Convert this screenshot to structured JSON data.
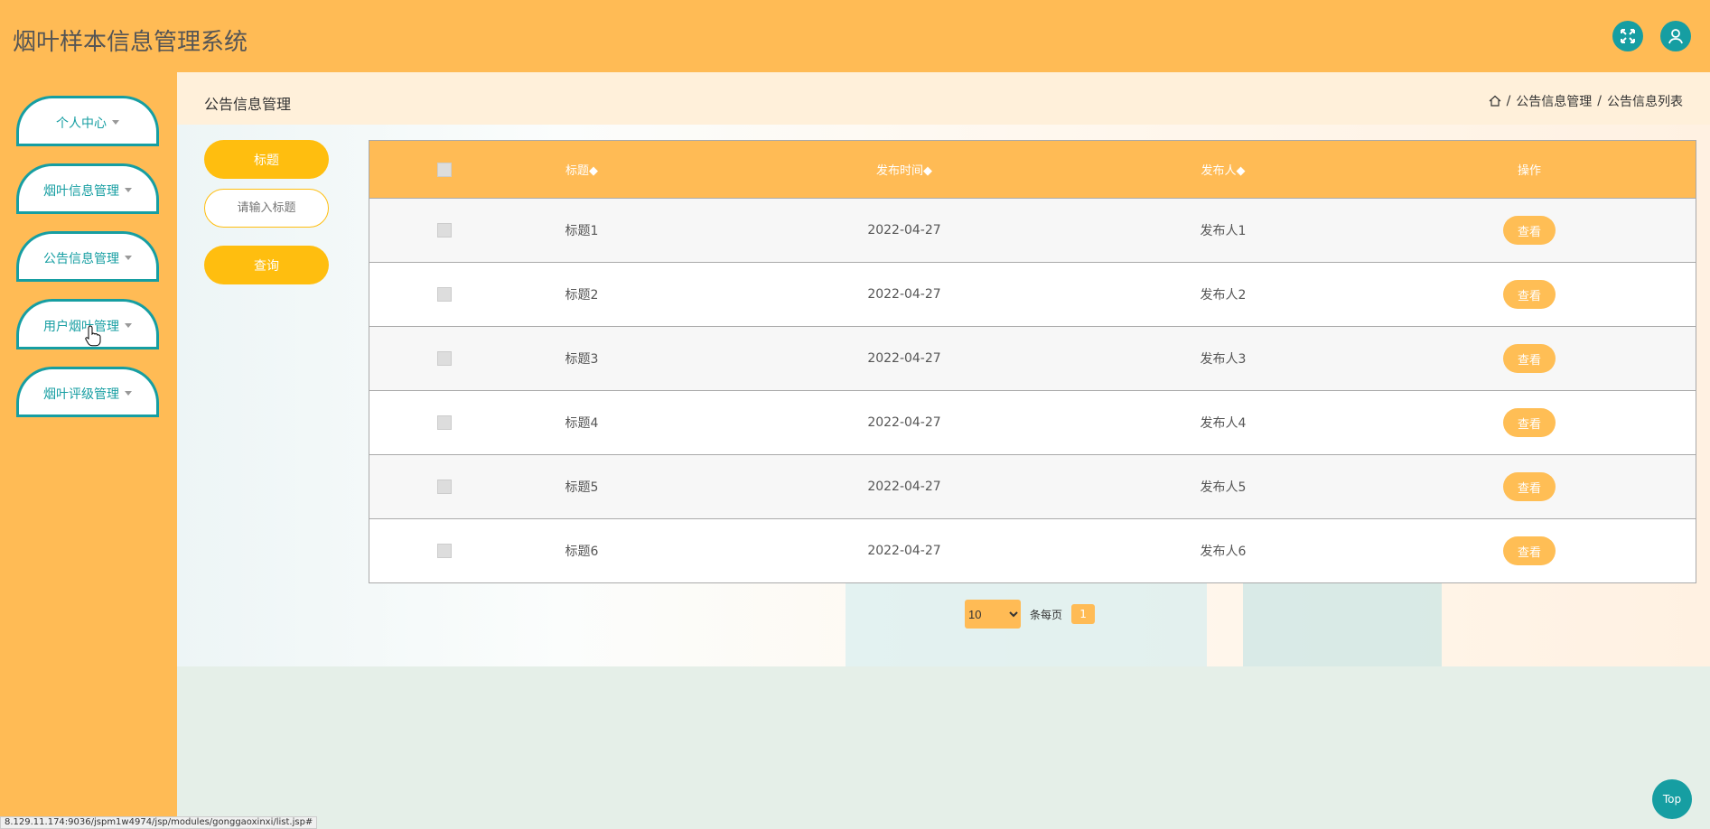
{
  "app": {
    "title": "烟叶样本信息管理系统"
  },
  "header": {
    "fullscreen_icon": "fullscreen-icon",
    "user_icon": "user-icon",
    "accent": "#169ea2"
  },
  "sidebar": {
    "items": [
      {
        "label": "个人中心"
      },
      {
        "label": "烟叶信息管理"
      },
      {
        "label": "公告信息管理"
      },
      {
        "label": "用户烟叶管理"
      },
      {
        "label": "烟叶评级管理"
      }
    ]
  },
  "page": {
    "title": "公告信息管理",
    "breadcrumb": [
      "公告信息管理",
      "公告信息列表"
    ]
  },
  "search": {
    "label": "标题",
    "placeholder": "请输入标题",
    "button": "查询"
  },
  "table": {
    "headers": [
      "标题",
      "发布时间",
      "发布人",
      "操作"
    ],
    "sort_marks": [
      "◆",
      "◆",
      "◆"
    ],
    "rows": [
      {
        "title": "标题1",
        "date": "2022-04-27",
        "publisher": "发布人1",
        "action": "查看"
      },
      {
        "title": "标题2",
        "date": "2022-04-27",
        "publisher": "发布人2",
        "action": "查看"
      },
      {
        "title": "标题3",
        "date": "2022-04-27",
        "publisher": "发布人3",
        "action": "查看"
      },
      {
        "title": "标题4",
        "date": "2022-04-27",
        "publisher": "发布人4",
        "action": "查看"
      },
      {
        "title": "标题5",
        "date": "2022-04-27",
        "publisher": "发布人5",
        "action": "查看"
      },
      {
        "title": "标题6",
        "date": "2022-04-27",
        "publisher": "发布人6",
        "action": "查看"
      }
    ]
  },
  "pager": {
    "page_size": "10",
    "per_page_label": "条每页",
    "current_page": "1"
  },
  "top_button": "Top",
  "status_url": "8.129.11.174:9036/jspm1w4974/jsp/modules/gonggaoxinxi/list.jsp#"
}
